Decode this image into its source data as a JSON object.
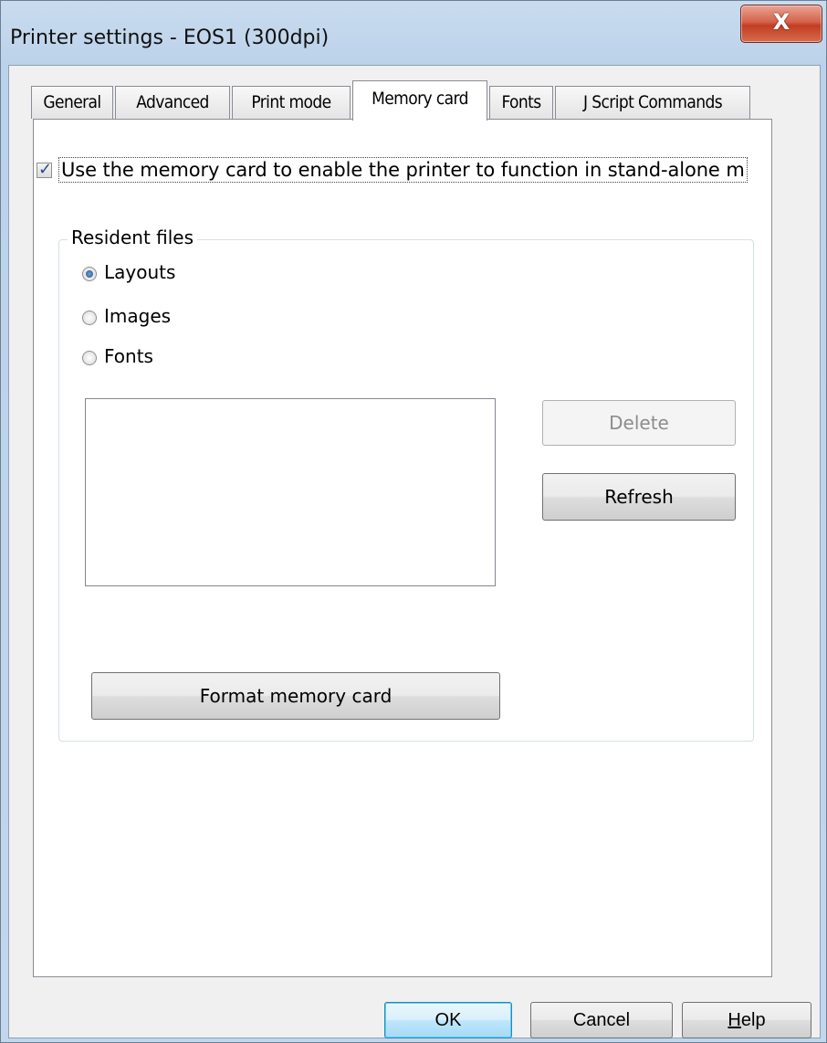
{
  "window": {
    "title": "Printer settings - EOS1 (300dpi)",
    "close_symbol": "X"
  },
  "tabs": [
    {
      "label": "General",
      "active": false
    },
    {
      "label": "Advanced",
      "active": false
    },
    {
      "label": "Print mode",
      "active": false
    },
    {
      "label": "Memory card",
      "active": true
    },
    {
      "label": "Fonts",
      "active": false
    },
    {
      "label": "J Script Commands",
      "active": false
    }
  ],
  "memory_card": {
    "enable_checkbox": {
      "checked": true,
      "check_glyph": "✓",
      "label": "Use the memory card to enable the printer to function in stand-alone m"
    },
    "resident_files": {
      "legend": "Resident files",
      "radios": [
        {
          "label": "Layouts",
          "selected": true
        },
        {
          "label": "Images",
          "selected": false
        },
        {
          "label": "Fonts",
          "selected": false
        }
      ],
      "list_items": []
    },
    "buttons": {
      "delete": "Delete",
      "refresh": "Refresh",
      "format": "Format memory card"
    }
  },
  "footer": {
    "ok": "OK",
    "cancel": "Cancel",
    "help_prefix": "H",
    "help_rest": "elp"
  },
  "colors": {
    "titlebar": "#c9dcef",
    "close_button": "#c33d22",
    "default_button_border": "#3c7fb1"
  }
}
